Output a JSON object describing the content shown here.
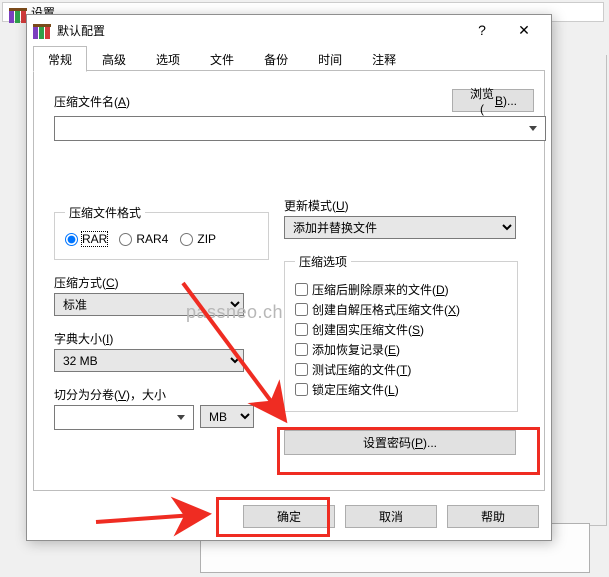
{
  "backdrop": {
    "title": "设置"
  },
  "titlebar": {
    "title": "默认配置",
    "help": "?",
    "close": "✕"
  },
  "tabs": {
    "general": "常规",
    "advanced": "高级",
    "options": "选项",
    "files": "文件",
    "backup": "备份",
    "time": "时间",
    "comment": "注释"
  },
  "archive": {
    "label_pre": "压缩文件名(",
    "label_key": "A",
    "label_post": ")",
    "browse_pre": "浏览(",
    "browse_key": "B",
    "browse_post": ")...",
    "value": ""
  },
  "format_group": {
    "legend": "压缩文件格式",
    "rar": "RAR",
    "rar4": "RAR4",
    "zip": "ZIP"
  },
  "method": {
    "label_pre": "压缩方式(",
    "label_key": "C",
    "label_post": ")",
    "value": "标准"
  },
  "dict": {
    "label_pre": "字典大小(",
    "label_key": "I",
    "label_post": ")",
    "value": "32 MB"
  },
  "split": {
    "label_pre": "切分为分卷(",
    "label_key": "V",
    "label_post": ")，大小",
    "unit": "MB",
    "value": ""
  },
  "update": {
    "label_pre": "更新模式(",
    "label_key": "U",
    "label_post": ")",
    "value": "添加并替换文件"
  },
  "options_group": {
    "legend": "压缩选项",
    "delete_pre": "压缩后删除原来的文件(",
    "delete_key": "D",
    "delete_post": ")",
    "sfx_pre": "创建自解压格式压缩文件(",
    "sfx_key": "X",
    "sfx_post": ")",
    "solid_pre": "创建固实压缩文件(",
    "solid_key": "S",
    "solid_post": ")",
    "recovery_pre": "添加恢复记录(",
    "recovery_key": "E",
    "recovery_post": ")",
    "test_pre": "测试压缩的文件(",
    "test_key": "T",
    "test_post": ")",
    "lock_pre": "锁定压缩文件(",
    "lock_key": "L",
    "lock_post": ")"
  },
  "password_btn": {
    "pre": "设置密码(",
    "key": "P",
    "post": ")..."
  },
  "footer": {
    "ok": "确定",
    "cancel": "取消",
    "help": "帮助"
  },
  "watermark": "passneo.ch"
}
